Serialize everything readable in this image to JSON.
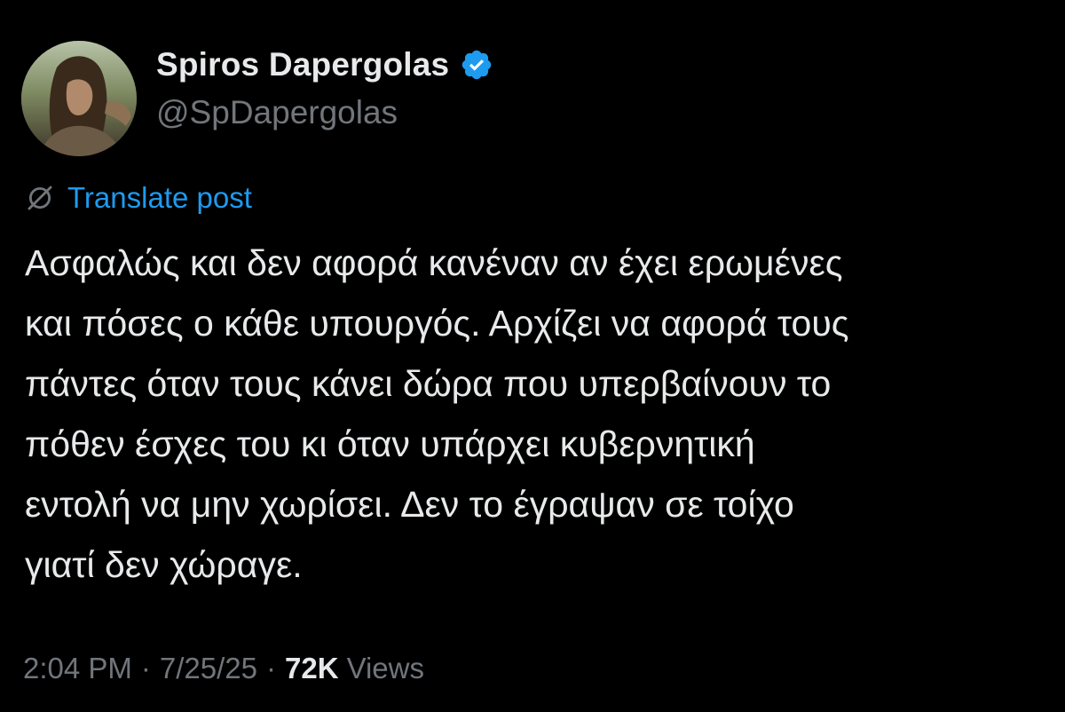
{
  "author": {
    "display_name": "Spiros Dapergolas",
    "handle": "@SpDapergolas",
    "verified_icon": "verified-badge-icon",
    "avatar": "profile-photo"
  },
  "translate": {
    "icon": "globe-icon",
    "label": "Translate post"
  },
  "post": {
    "lines": [
      "Ασφαλώς και δεν αφορά κανέναν αν έχει ερωμένες",
      "και πόσες ο κάθε υπουργός. Αρχίζει να αφορά τους",
      "πάντες όταν τους κάνει δώρα που υπερβαίνουν το",
      "πόθεν έσχες του κι όταν υπάρχει κυβερνητική",
      "εντολή να μην χωρίσει. Δεν το έγραψαν σε τοίχο",
      "γιατί δεν χώραγε."
    ]
  },
  "meta": {
    "time": "2:04 PM",
    "separator": "·",
    "date": "7/25/25",
    "views_count": "72K",
    "views_label": "Views"
  },
  "colors": {
    "background": "#000000",
    "primary_text": "#e7e9ea",
    "secondary_text": "#71767b",
    "accent_blue": "#1d9bf0"
  }
}
